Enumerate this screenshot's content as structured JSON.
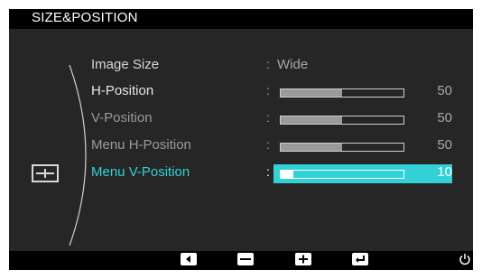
{
  "osd": {
    "title": "SIZE&POSITION",
    "category_icon": "size-position-icon",
    "items": [
      {
        "label": "Image Size",
        "value_text": "Wide",
        "label_color": "#d8d8d8"
      },
      {
        "label": "H-Position",
        "value": 50,
        "label_color": "#e6e6e6"
      },
      {
        "label": "V-Position",
        "value": 50,
        "label_color": "#9a9a9a"
      },
      {
        "label": "Menu H-Position",
        "value": 50,
        "label_color": "#9a9a9a"
      },
      {
        "label": "Menu V-Position",
        "value": 10,
        "label_color": "#33d1d6",
        "selected": true
      }
    ],
    "bar_fill_fraction": {
      "H-Position": 0.5,
      "V-Position": 0.5,
      "Menu H-Position": 0.5,
      "Menu V-Position": 0.1
    },
    "colors": {
      "accent": "#33d1d6",
      "background": "#262626",
      "bar": "#000000"
    },
    "buttons": [
      {
        "icon": "left-arrow-icon"
      },
      {
        "icon": "minus-icon"
      },
      {
        "icon": "plus-icon"
      },
      {
        "icon": "enter-icon"
      },
      {
        "icon": "power-icon"
      }
    ]
  }
}
